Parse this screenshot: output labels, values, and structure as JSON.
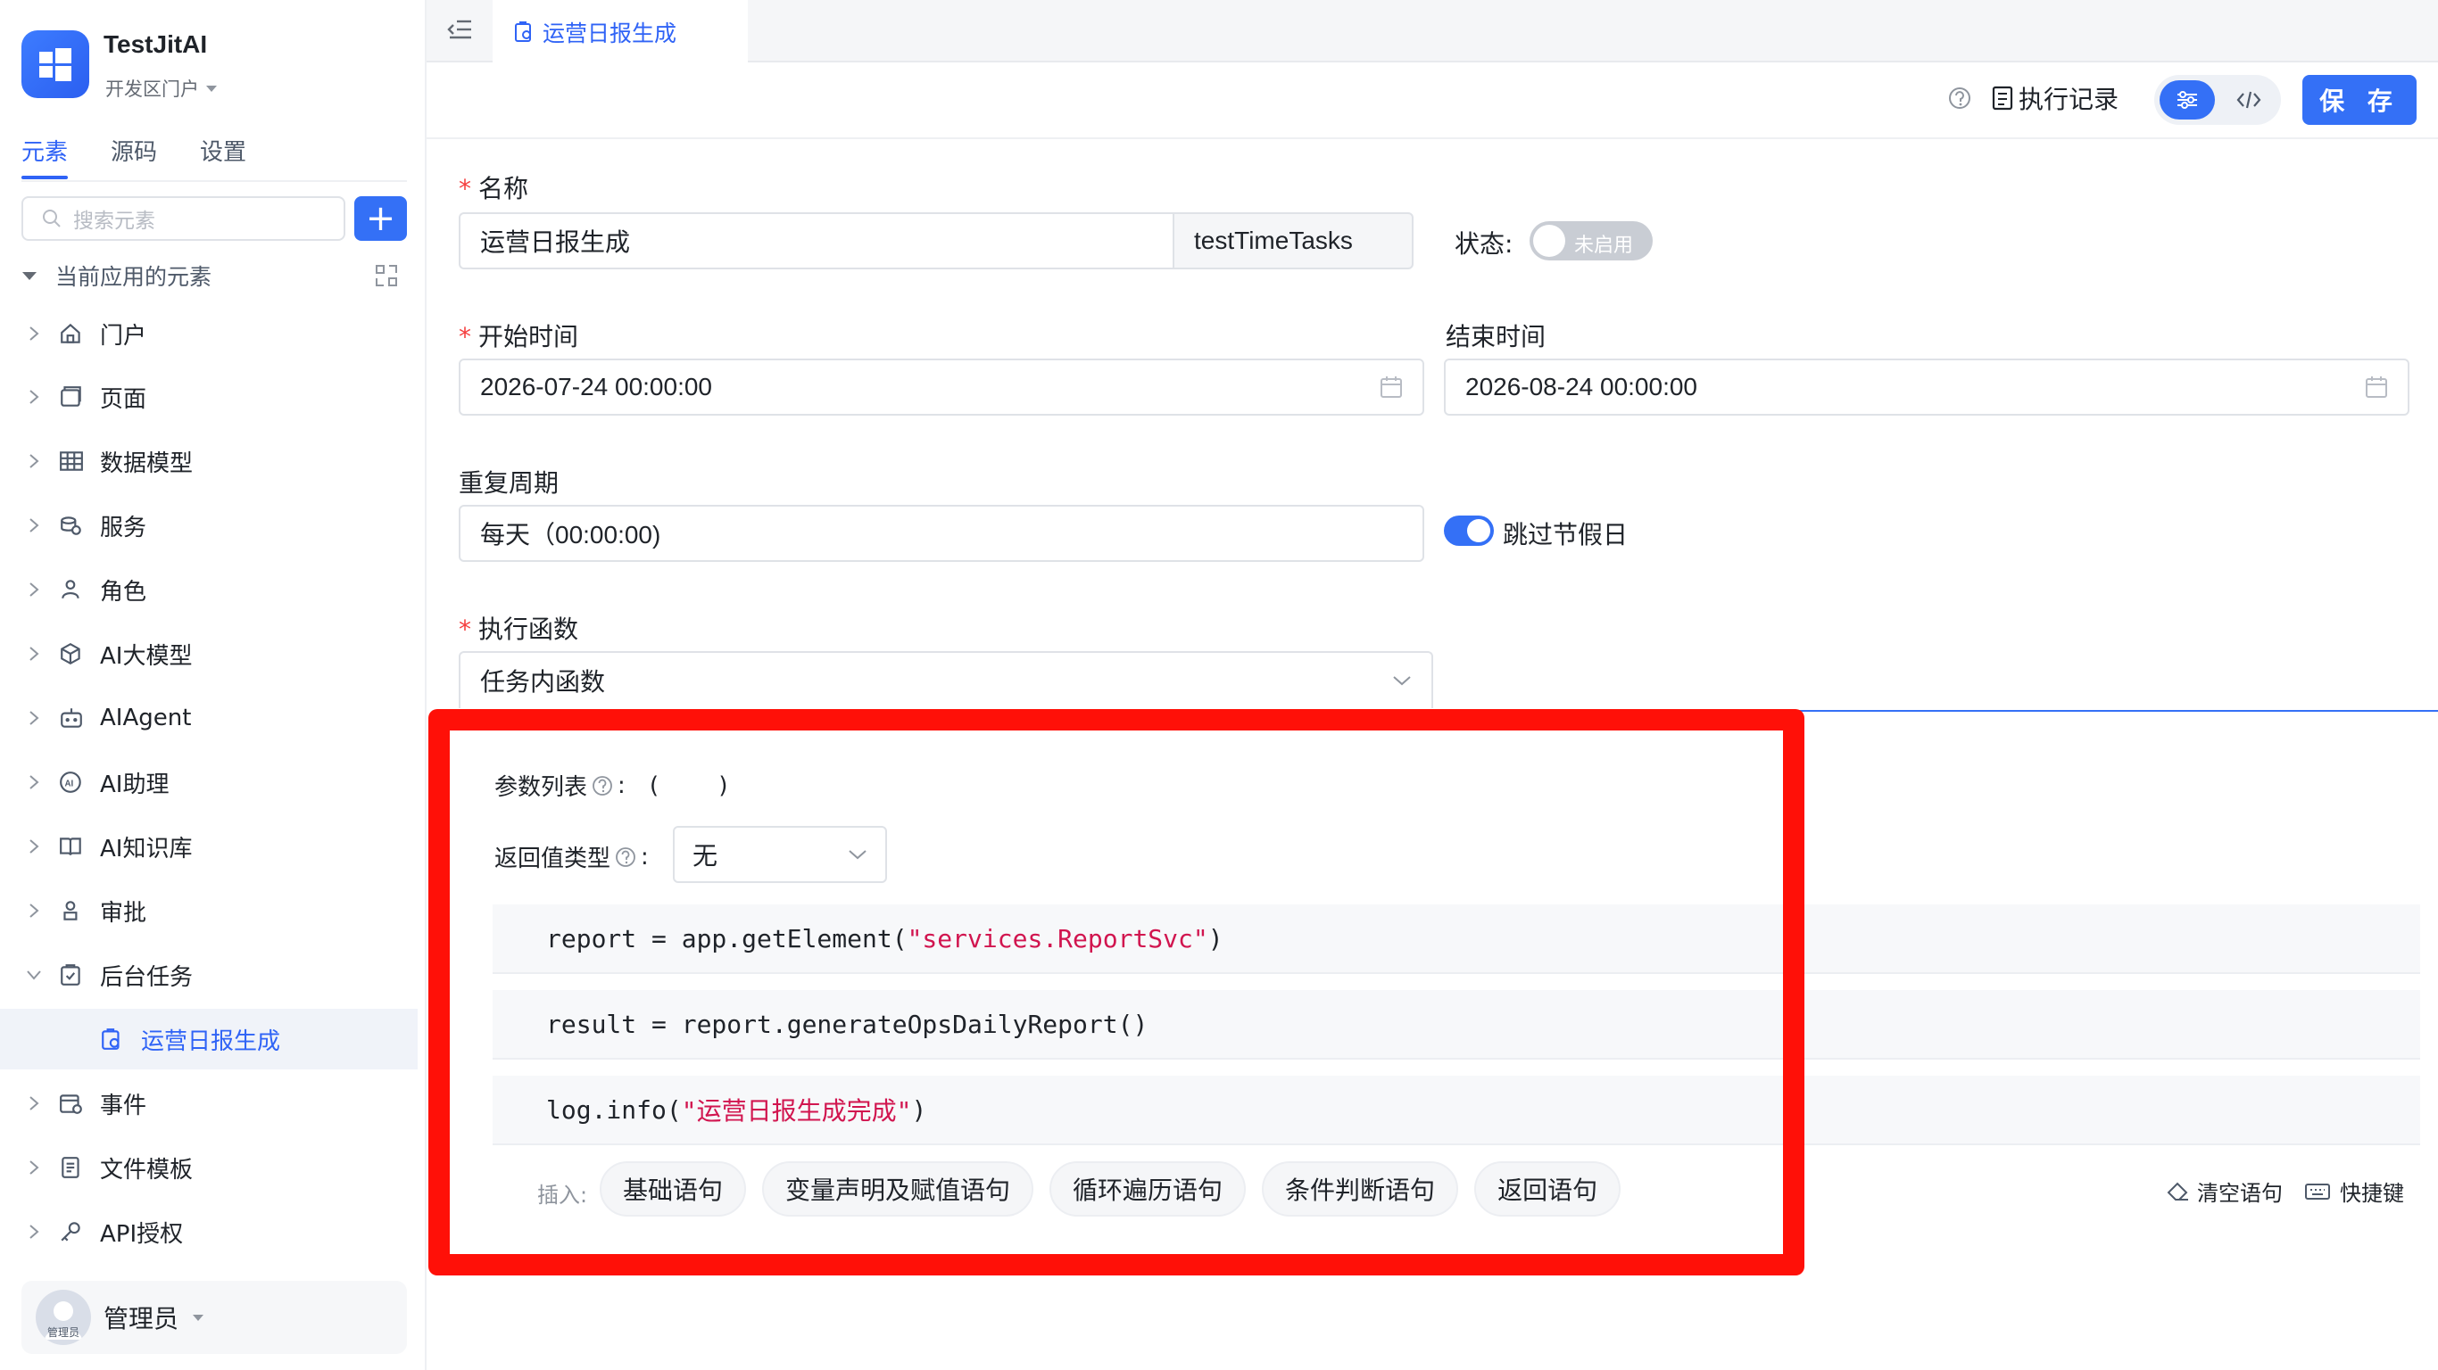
{
  "app": {
    "name": "TestJitAI",
    "portal": "开发区门户"
  },
  "sidebar": {
    "tabs": [
      {
        "label": "元素"
      },
      {
        "label": "源码"
      },
      {
        "label": "设置"
      }
    ],
    "search_placeholder": "搜索元素",
    "add_label": "+",
    "section_title": "当前应用的元素",
    "items": [
      {
        "label": "门户",
        "icon": "home-icon"
      },
      {
        "label": "页面",
        "icon": "page-icon"
      },
      {
        "label": "数据模型",
        "icon": "table-icon"
      },
      {
        "label": "服务",
        "icon": "service-icon"
      },
      {
        "label": "角色",
        "icon": "role-icon"
      },
      {
        "label": "AI大模型",
        "icon": "cube-icon"
      },
      {
        "label": "AIAgent",
        "icon": "robot-icon"
      },
      {
        "label": "AI助理",
        "icon": "ai-assistant-icon"
      },
      {
        "label": "AI知识库",
        "icon": "book-icon"
      },
      {
        "label": "审批",
        "icon": "approval-icon"
      },
      {
        "label": "后台任务",
        "icon": "task-icon"
      },
      {
        "label": "运营日报生成",
        "icon": "task-file-icon"
      },
      {
        "label": "事件",
        "icon": "event-icon"
      },
      {
        "label": "文件模板",
        "icon": "file-template-icon"
      },
      {
        "label": "API授权",
        "icon": "key-icon"
      }
    ],
    "user": {
      "name": "管理员",
      "avatar_text": "管理员"
    }
  },
  "editor_tab": {
    "label": "运营日报生成"
  },
  "toolbar": {
    "records_label": "执行记录",
    "save_label": "保 存"
  },
  "form": {
    "name_label": "名称",
    "name_value": "运营日报生成",
    "code_value": "testTimeTasks",
    "status_label": "状态:",
    "status_value": "未启用",
    "start_label": "开始时间",
    "start_value": "2026-07-24 00:00:00",
    "end_label": "结束时间",
    "end_value": "2026-08-24 00:00:00",
    "repeat_label": "重复周期",
    "repeat_value": "每天（00:00:00)",
    "skip_holiday_label": "跳过节假日",
    "func_label": "执行函数",
    "func_value": "任务内函数"
  },
  "function": {
    "params_label": "参数列表",
    "params_value": "(    )",
    "return_label": "返回值类型",
    "return_value": "无",
    "code": [
      {
        "pre": "report = app.getElement(",
        "str": "\"services.ReportSvc\"",
        "post": ")"
      },
      {
        "pre": "result = report.generateOpsDailyReport()",
        "str": "",
        "post": ""
      },
      {
        "pre": "log.info(",
        "str": "\"运营日报生成完成\"",
        "post": ")"
      }
    ],
    "insert_label": "插入:",
    "insert_chips": [
      "基础语句",
      "变量声明及赋值语句",
      "循环遍历语句",
      "条件判断语句",
      "返回语句"
    ],
    "clear_label": "清空语句",
    "shortcut_label": "快捷键"
  }
}
